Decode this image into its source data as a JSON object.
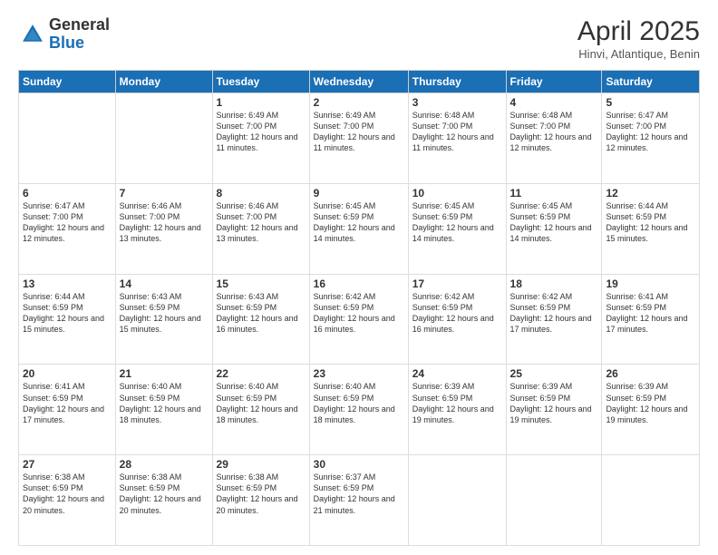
{
  "logo": {
    "general": "General",
    "blue": "Blue"
  },
  "header": {
    "month_year": "April 2025",
    "location": "Hinvi, Atlantique, Benin"
  },
  "days_of_week": [
    "Sunday",
    "Monday",
    "Tuesday",
    "Wednesday",
    "Thursday",
    "Friday",
    "Saturday"
  ],
  "weeks": [
    [
      {
        "day": "",
        "info": ""
      },
      {
        "day": "",
        "info": ""
      },
      {
        "day": "1",
        "info": "Sunrise: 6:49 AM\nSunset: 7:00 PM\nDaylight: 12 hours and 11 minutes."
      },
      {
        "day": "2",
        "info": "Sunrise: 6:49 AM\nSunset: 7:00 PM\nDaylight: 12 hours and 11 minutes."
      },
      {
        "day": "3",
        "info": "Sunrise: 6:48 AM\nSunset: 7:00 PM\nDaylight: 12 hours and 11 minutes."
      },
      {
        "day": "4",
        "info": "Sunrise: 6:48 AM\nSunset: 7:00 PM\nDaylight: 12 hours and 12 minutes."
      },
      {
        "day": "5",
        "info": "Sunrise: 6:47 AM\nSunset: 7:00 PM\nDaylight: 12 hours and 12 minutes."
      }
    ],
    [
      {
        "day": "6",
        "info": "Sunrise: 6:47 AM\nSunset: 7:00 PM\nDaylight: 12 hours and 12 minutes."
      },
      {
        "day": "7",
        "info": "Sunrise: 6:46 AM\nSunset: 7:00 PM\nDaylight: 12 hours and 13 minutes."
      },
      {
        "day": "8",
        "info": "Sunrise: 6:46 AM\nSunset: 7:00 PM\nDaylight: 12 hours and 13 minutes."
      },
      {
        "day": "9",
        "info": "Sunrise: 6:45 AM\nSunset: 6:59 PM\nDaylight: 12 hours and 14 minutes."
      },
      {
        "day": "10",
        "info": "Sunrise: 6:45 AM\nSunset: 6:59 PM\nDaylight: 12 hours and 14 minutes."
      },
      {
        "day": "11",
        "info": "Sunrise: 6:45 AM\nSunset: 6:59 PM\nDaylight: 12 hours and 14 minutes."
      },
      {
        "day": "12",
        "info": "Sunrise: 6:44 AM\nSunset: 6:59 PM\nDaylight: 12 hours and 15 minutes."
      }
    ],
    [
      {
        "day": "13",
        "info": "Sunrise: 6:44 AM\nSunset: 6:59 PM\nDaylight: 12 hours and 15 minutes."
      },
      {
        "day": "14",
        "info": "Sunrise: 6:43 AM\nSunset: 6:59 PM\nDaylight: 12 hours and 15 minutes."
      },
      {
        "day": "15",
        "info": "Sunrise: 6:43 AM\nSunset: 6:59 PM\nDaylight: 12 hours and 16 minutes."
      },
      {
        "day": "16",
        "info": "Sunrise: 6:42 AM\nSunset: 6:59 PM\nDaylight: 12 hours and 16 minutes."
      },
      {
        "day": "17",
        "info": "Sunrise: 6:42 AM\nSunset: 6:59 PM\nDaylight: 12 hours and 16 minutes."
      },
      {
        "day": "18",
        "info": "Sunrise: 6:42 AM\nSunset: 6:59 PM\nDaylight: 12 hours and 17 minutes."
      },
      {
        "day": "19",
        "info": "Sunrise: 6:41 AM\nSunset: 6:59 PM\nDaylight: 12 hours and 17 minutes."
      }
    ],
    [
      {
        "day": "20",
        "info": "Sunrise: 6:41 AM\nSunset: 6:59 PM\nDaylight: 12 hours and 17 minutes."
      },
      {
        "day": "21",
        "info": "Sunrise: 6:40 AM\nSunset: 6:59 PM\nDaylight: 12 hours and 18 minutes."
      },
      {
        "day": "22",
        "info": "Sunrise: 6:40 AM\nSunset: 6:59 PM\nDaylight: 12 hours and 18 minutes."
      },
      {
        "day": "23",
        "info": "Sunrise: 6:40 AM\nSunset: 6:59 PM\nDaylight: 12 hours and 18 minutes."
      },
      {
        "day": "24",
        "info": "Sunrise: 6:39 AM\nSunset: 6:59 PM\nDaylight: 12 hours and 19 minutes."
      },
      {
        "day": "25",
        "info": "Sunrise: 6:39 AM\nSunset: 6:59 PM\nDaylight: 12 hours and 19 minutes."
      },
      {
        "day": "26",
        "info": "Sunrise: 6:39 AM\nSunset: 6:59 PM\nDaylight: 12 hours and 19 minutes."
      }
    ],
    [
      {
        "day": "27",
        "info": "Sunrise: 6:38 AM\nSunset: 6:59 PM\nDaylight: 12 hours and 20 minutes."
      },
      {
        "day": "28",
        "info": "Sunrise: 6:38 AM\nSunset: 6:59 PM\nDaylight: 12 hours and 20 minutes."
      },
      {
        "day": "29",
        "info": "Sunrise: 6:38 AM\nSunset: 6:59 PM\nDaylight: 12 hours and 20 minutes."
      },
      {
        "day": "30",
        "info": "Sunrise: 6:37 AM\nSunset: 6:59 PM\nDaylight: 12 hours and 21 minutes."
      },
      {
        "day": "",
        "info": ""
      },
      {
        "day": "",
        "info": ""
      },
      {
        "day": "",
        "info": ""
      }
    ]
  ]
}
